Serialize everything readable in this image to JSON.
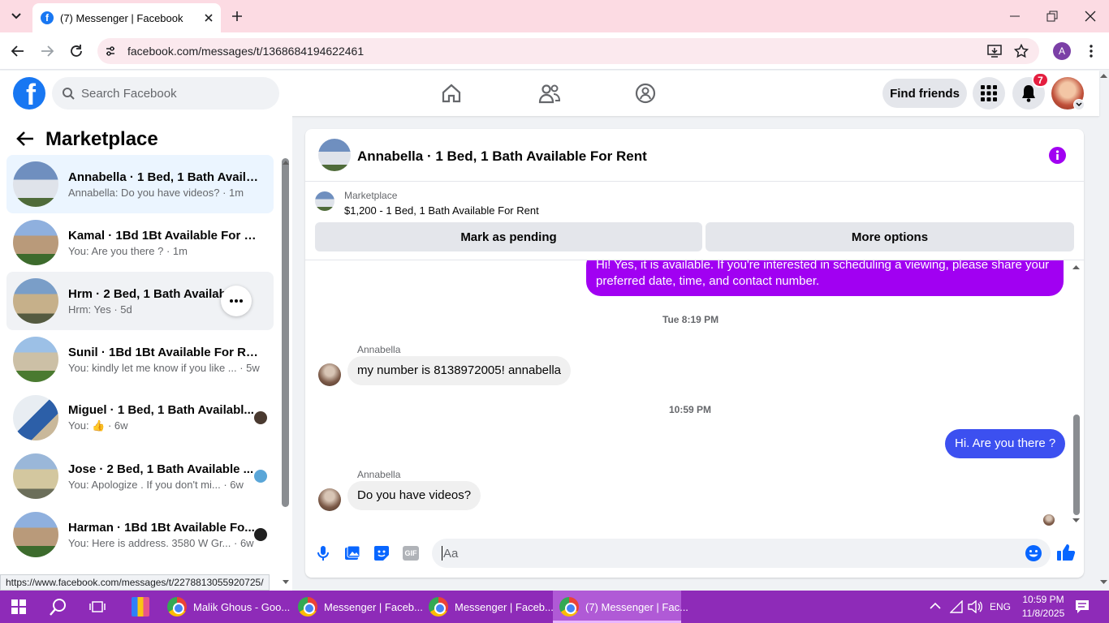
{
  "browser": {
    "tab_title": "(7) Messenger | Facebook",
    "url": "facebook.com/messages/t/1368684194622461",
    "profile_initial": "A",
    "status_url": "https://www.facebook.com/messages/t/2278813055920725/"
  },
  "fb_header": {
    "logo_letter": "f",
    "search_placeholder": "Search Facebook",
    "find_friends_label": "Find friends",
    "notification_count": "7"
  },
  "left_panel": {
    "title": "Marketplace",
    "conversations": [
      {
        "name": "Annabella · 1 Bed, 1 Bath Availab...",
        "preview": "Annabella: Do you have videos? · 1m"
      },
      {
        "name": "Kamal · 1Bd 1Bt Available For Re...",
        "preview": "You: Are you there ? · 1m"
      },
      {
        "name": "Hrm · 2 Bed, 1 Bath Available ...",
        "preview": "Hrm: Yes · 5d"
      },
      {
        "name": "Sunil · 1Bd 1Bt Available For Ren...",
        "preview": "You: kindly let me know if you like ... · 5w"
      },
      {
        "name": "Miguel · 1 Bed, 1 Bath Availabl...",
        "preview": "You: 👍 · 6w"
      },
      {
        "name": "Jose · 2 Bed, 1 Bath Available ...",
        "preview": "You: Apologize . If you don't mi... · 6w"
      },
      {
        "name": "Harman · 1Bd 1Bt Available Fo...",
        "preview": "You: Here is address. 3580 W Gr... · 6w"
      }
    ]
  },
  "chat": {
    "title": "Annabella · 1 Bed, 1 Bath Available For Rent",
    "marketplace_label": "Marketplace",
    "listing": "$1,200 - 1 Bed, 1 Bath Available For Rent",
    "mark_pending_label": "Mark as pending",
    "more_options_label": "More options",
    "messages": {
      "m1": "Hi! Yes, it is available. If you're interested in scheduling a viewing, please share your preferred date, time, and contact number.",
      "stamp1": "Tue 8:19 PM",
      "sender1": "Annabella",
      "m2": "my number is 8138972005! annabella",
      "stamp2": "10:59 PM",
      "m3": "Hi. Are you there ?",
      "sender2": "Annabella",
      "m4": "Do you have videos?"
    },
    "composer_placeholder": "Aa",
    "gif_label": "GIF"
  },
  "taskbar": {
    "apps": [
      {
        "label": "Malik Ghous - Goo..."
      },
      {
        "label": "Messenger | Faceb..."
      },
      {
        "label": "Messenger | Faceb..."
      },
      {
        "label": "(7) Messenger | Fac..."
      }
    ],
    "language": "ENG",
    "time": "10:59 PM",
    "date": "11/8/2025"
  },
  "colors": {
    "fb_blue": "#1877f2",
    "outgoing_purple": "#a100f2",
    "outgoing_blue": "#3c50f0",
    "taskbar": "#8e2bb8"
  }
}
